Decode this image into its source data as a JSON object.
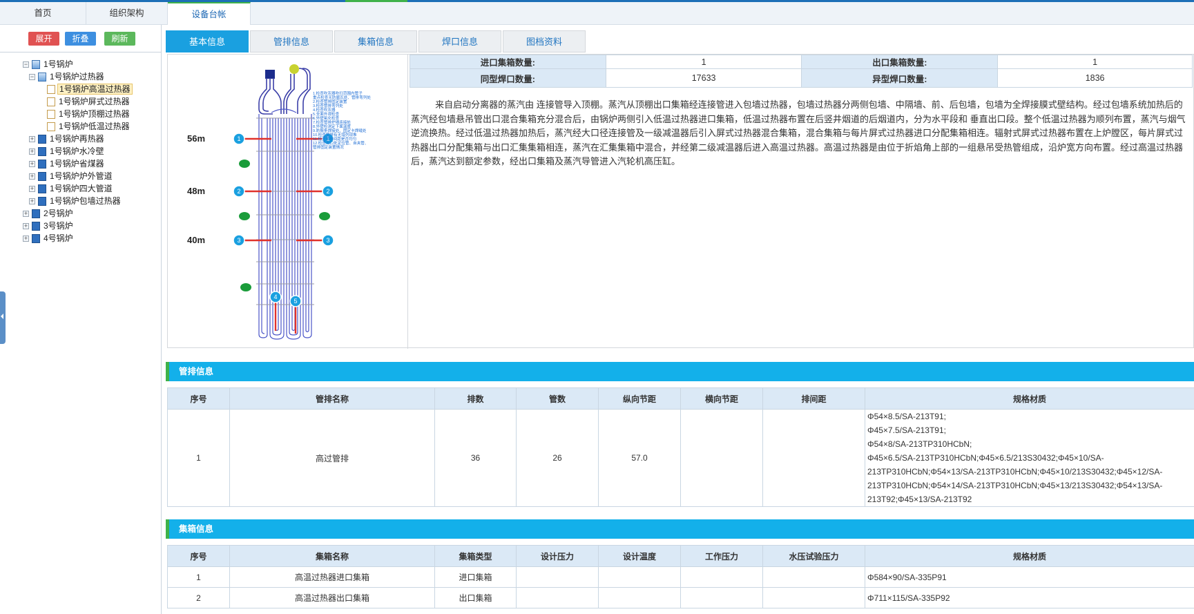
{
  "top_tabs": [
    "首页",
    "组织架构",
    "设备台帐"
  ],
  "sidebar": {
    "buttons": {
      "expand": "展开",
      "collapse": "折叠",
      "refresh": "刷新"
    },
    "tree": [
      "1号锅炉",
      "1号锅炉过热器",
      "1号锅炉高温过热器",
      "1号锅炉屏式过热器",
      "1号锅炉顶棚过热器",
      "1号锅炉低温过热器",
      "1号锅炉再热器",
      "1号锅炉水冷壁",
      "1号锅炉省煤器",
      "1号锅炉炉外管道",
      "1号锅炉四大管道",
      "1号锅炉包墙过热器",
      "2号锅炉",
      "3号锅炉",
      "4号锅炉"
    ]
  },
  "sub_tabs": [
    "基本信息",
    "管排信息",
    "集箱信息",
    "焊口信息",
    "图档资料"
  ],
  "colors": {
    "accent": "#1aa0e0",
    "header_bg": "#13b0ea",
    "green": "#3fb24a",
    "th_bg": "#dbe9f6"
  },
  "basic": {
    "levels": [
      "56m",
      "48m",
      "40m"
    ],
    "markers": [
      "1",
      "1",
      "2",
      "2",
      "3",
      "3",
      "4",
      "5"
    ],
    "legend_lines": [
      "1.检查吹灰器吹扫范围内管子",
      "重点检查无防磨瓦处、管排弯列处",
      "2.检查管排固定装置",
      "3.检查管排弯列处",
      "4.检查吹灰器",
      "5.全面外观检查",
      "6.外壁氧化检查",
      "7.检查管排炉墙连接处",
      "8.外壁检测定下面温度",
      "9.防振条焊接处、固定卡焊缝处",
      "10.检查管排有无错列现象",
      "11.检查管排间距是否均匀",
      "12.检查出口处定位管、自夹管、",
      "管排固定装置情况"
    ],
    "info": [
      {
        "k1": "进口集箱数量:",
        "v1": "1",
        "k2": "出口集箱数量:",
        "v2": "1"
      },
      {
        "k1": "同型焊口数量:",
        "v1": "17633",
        "k2": "异型焊口数量:",
        "v2": "1836"
      }
    ],
    "description": "来自启动分离器的蒸汽由 连接管导入顶棚。蒸汽从顶棚出口集箱经连接管进入包墙过热器，包墙过热器分两侧包墙、中隔墙、前、后包墙，包墙为全焊接膜式壁结构。经过包墙系统加热后的蒸汽经包墙悬吊管出口混合集箱充分混合后，由锅炉两侧引入低温过热器进口集箱，低温过热器布置在后竖井烟道的后烟道内，分为水平段和 垂直出口段。整个低温过热器为顺列布置，蒸汽与烟气逆流换热。经过低温过热器加热后，蒸汽经大口径连接管及一级减温器后引入屏式过热器混合集箱，混合集箱与每片屏式过热器进口分配集箱相连。辐射式屏式过热器布置在上炉膛区，每片屏式过热器出口分配集箱与出口汇集集箱相连，蒸汽在汇集集箱中混合，并经第二级减温器后进入高温过热器。高温过热器是由位于折焰角上部的一组悬吊受热管组成，沿炉宽方向布置。经过高温过热器后，蒸汽达到额定参数，经出口集箱及蒸汽导管进入汽轮机高压缸。"
  },
  "pipe_section": {
    "title": "管排信息",
    "headers": [
      "序号",
      "管排名称",
      "排数",
      "管数",
      "纵向节距",
      "横向节距",
      "排间距",
      "规格材质"
    ],
    "rows": [
      {
        "no": "1",
        "name": "高过管排",
        "rows": "36",
        "tubes": "26",
        "long_pitch": "57.0",
        "trans_pitch": "",
        "row_gap": "",
        "spec": [
          "Φ54×8.5/SA-213T91;",
          "Φ45×7.5/SA-213T91;",
          "Φ54×8/SA-213TP310HCbN;",
          "Φ45×6.5/SA-213TP310HCbN;Φ45×6.5/213S30432;Φ45×10/SA-",
          "213TP310HCbN;Φ54×13/SA-213TP310HCbN;Φ45×10/213S30432;Φ45×12/SA-",
          "213TP310HCbN;Φ54×14/SA-213TP310HCbN;Φ45×13/213S30432;Φ54×13/SA-",
          "213T92;Φ45×13/SA-213T92"
        ]
      }
    ]
  },
  "header_section": {
    "title": "集箱信息",
    "headers": [
      "序号",
      "集箱名称",
      "集箱类型",
      "设计压力",
      "设计温度",
      "工作压力",
      "水压试验压力",
      "规格材质"
    ],
    "rows": [
      {
        "no": "1",
        "name": "高温过热器进口集箱",
        "type": "进口集箱",
        "spec": "Φ584×90/SA-335P91"
      },
      {
        "no": "2",
        "name": "高温过热器出口集箱",
        "type": "出口集箱",
        "spec": "Φ711×115/SA-335P92"
      }
    ]
  }
}
